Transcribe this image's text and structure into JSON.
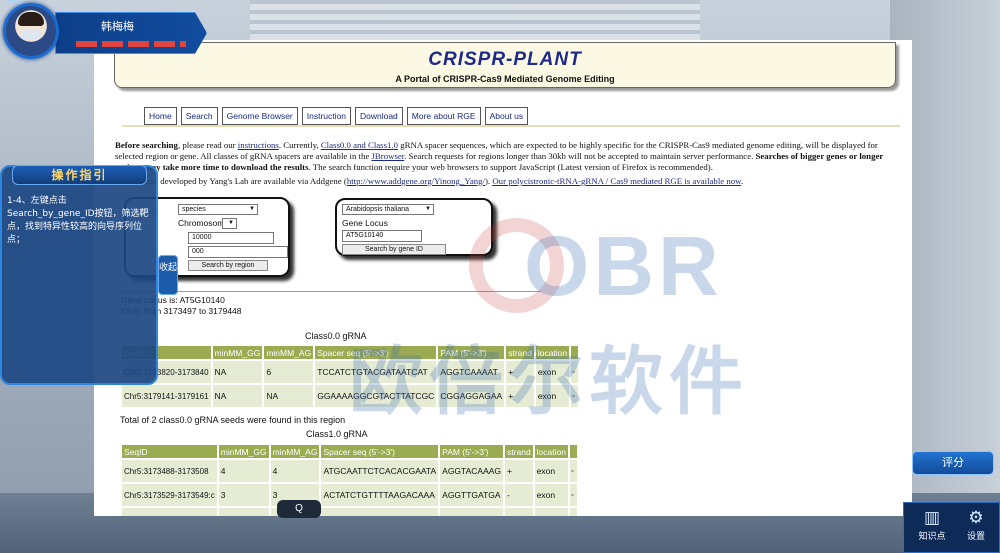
{
  "user": {
    "name": "韩梅梅",
    "tag": "ROLE"
  },
  "banner": {
    "title": "CRISPR-PLANT",
    "subtitle": "A Portal of CRISPR-Cas9 Mediated Genome Editing"
  },
  "nav": [
    "Home",
    "Search",
    "Genome Browser",
    "Instruction",
    "Download",
    "More about RGE",
    "About us"
  ],
  "intro": {
    "p1_a": "Before searching",
    "p1_b": ", please read our ",
    "link_instructions": "instructions",
    "p1_c": ". Currently, ",
    "link_class": "Class0.0 and Class1.0",
    "p1_d": " gRNA spacer sequences, which are expected to be highly specific for the CRISPR-Cas9 mediated genome editing, will be displayed for selected region or gene. All classes of gRNA spacers are available in the ",
    "link_jbrowser": "JBrowser",
    "p1_e": ". Search requests for regions longer than 30kb will not be accepted to maintain server performance. ",
    "p1_bold": "Searches of bigger genes or longer regions may take more time to download the results",
    "p1_f": ". The search function require your web browsers to support JavaScript (Latest version of Firefox is recommended).",
    "p2_a": "Two vectors developed by Yang's Lab are available via Addgene (",
    "link_addgene": "http://www.addgene.org/Yinong_Yang/",
    "p2_b": "). ",
    "link_polycistronic": "Our polycistronic-tRNA-gRNA / Cas9 mediated RGE is available now",
    "p2_c": "."
  },
  "form_region": {
    "species_select": "species",
    "chromosome_label": "Chromosome",
    "start_value": "10000",
    "end_value": "000",
    "search_button": "Search by region"
  },
  "form_gene": {
    "species_select": "Arabidopsis thaliana",
    "gene_label": "Gene Locus",
    "gene_value": "AT5G10140",
    "search_button": "Search by gene ID"
  },
  "result_meta": {
    "locus": "Gene Locus is: AT5G10140",
    "range": "Chr5: from 3173497 to 3179448"
  },
  "class00": {
    "caption": "Class0.0 gRNA",
    "headers": [
      "SeqID",
      "minMM_GG",
      "minMM_AG",
      "Spacer seq (5'->3')",
      "PAM (5'->3')",
      "strand",
      "location",
      ""
    ],
    "rows": [
      [
        "Chr5:3173820-3173840",
        "NA",
        "6",
        "TCCATCTGTACGATAATCAT",
        "AGGTCAAAAT",
        "+",
        "exon",
        "▫"
      ],
      [
        "Chr5:3179141-3179161",
        "NA",
        "NA",
        "GGAAAAGGCGTACTTATCGC",
        "CGGAGGAGAA",
        "+",
        "exon",
        "▫"
      ]
    ],
    "total": "Total of 2 class0.0 gRNA seeds were found in this region"
  },
  "class10": {
    "caption": "Class1.0 gRNA",
    "headers": [
      "SeqID",
      "minMM_GG",
      "minMM_AG",
      "Spacer seq (5'->3')",
      "PAM (5'->3')",
      "strand",
      "location",
      ""
    ],
    "rows": [
      [
        "Chr5:3173488-3173508",
        "4",
        "4",
        "ATGCAATTCTCACACGAATA",
        "AGGTACAAAG",
        "+",
        "exon",
        "▫"
      ],
      [
        "Chr5:3173529-3173549:c",
        "3",
        "3",
        "ACTATCTGTTTTAAGACAAA",
        "AGGTTGATGA",
        "-",
        "exon",
        "▫"
      ],
      [
        "Chr5:3173633-",
        "",
        "",
        "",
        "",
        "",
        "",
        ""
      ]
    ]
  },
  "watermark": {
    "latin": "OBR",
    "chinese": "欧倍尔软件"
  },
  "guide": {
    "title": "操作指引",
    "text": "1-4、左键点击Search_by_gene_ID按钮，筛选靶点，找到特异性较高的向导序列位点；",
    "collapse": "收起"
  },
  "controls": {
    "score": "评分",
    "knowledge": "知识点",
    "settings": "设置",
    "search_hint": "Q"
  },
  "colors": {
    "table_header": "#9bab52",
    "table_cell": "#e6ecd4",
    "banner_bg": "#fbf8e4",
    "ui_blue": "#124b98"
  }
}
